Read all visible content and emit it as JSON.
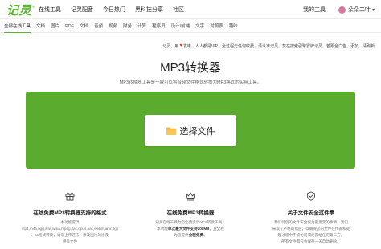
{
  "nav": {
    "logo": "记灵",
    "logo_mark": "®",
    "links": [
      "在线工具",
      "记灵配音",
      "今日热门",
      "黑科技分享",
      "社区"
    ],
    "mine": "我的工具",
    "user_name": "朵朵二叶",
    "avatar_color": "#d77aa0"
  },
  "categories": {
    "active_index": 0,
    "items": [
      "全部在线工具",
      "文档",
      "图片",
      "PDF",
      "文档",
      "音频",
      "视频",
      "财务",
      "计算",
      "程序员",
      "设计/前端",
      "文字",
      "对照表",
      "趣味"
    ]
  },
  "notice": {
    "part1": "记灵，用",
    "part2": "发电，人人都是VIP，全过程无任何收费，请认准记灵，莫在搜索引擎冒牌记灵，若跟全广告，添加，请刷新"
  },
  "page": {
    "title": "MP3转换器",
    "subtitle": "MP3转换器工具是一款可以将音频文件格式转换为MP3格式的实用工具。"
  },
  "upload": {
    "button_label": "选择文件",
    "panel_color": "#5bab2f",
    "folder_color": "#f5b53f"
  },
  "features": [
    {
      "icon": "gift-icon",
      "title": "在线免费MP3转换器支持的格式",
      "lines": [
        "本功能提供",
        "mp4,m4a,ogg,wav,wma,mpeg,flac,opus,aac,webm,amr,3gp",
        "、ss格式转换，请勿上传违法、涉及图片的涉及",
        "相关文件"
      ]
    },
    {
      "icon": "crown-icon",
      "title": "在线免费MP3转换器",
      "lines": [
        "记灵在线工具为您免费提供MP3转换工具，",
        "本功能单次最大文件支持200MB，且全程",
        "为您提供全程免费。"
      ],
      "bold": [
        "单次最大文件支持200MB",
        "全程免费"
      ]
    },
    {
      "icon": "shield-icon",
      "title": "关于文件安全这件事",
      "lines": [
        "我们将您的文件安全视为最重要的事情，我们",
        "采取了严格的措施，以确保您的文件在传输和处",
        "理过程中不被访问或泄露给任何第三方。",
        "所有文件都只会保存一天自动删除。"
      ]
    }
  ]
}
